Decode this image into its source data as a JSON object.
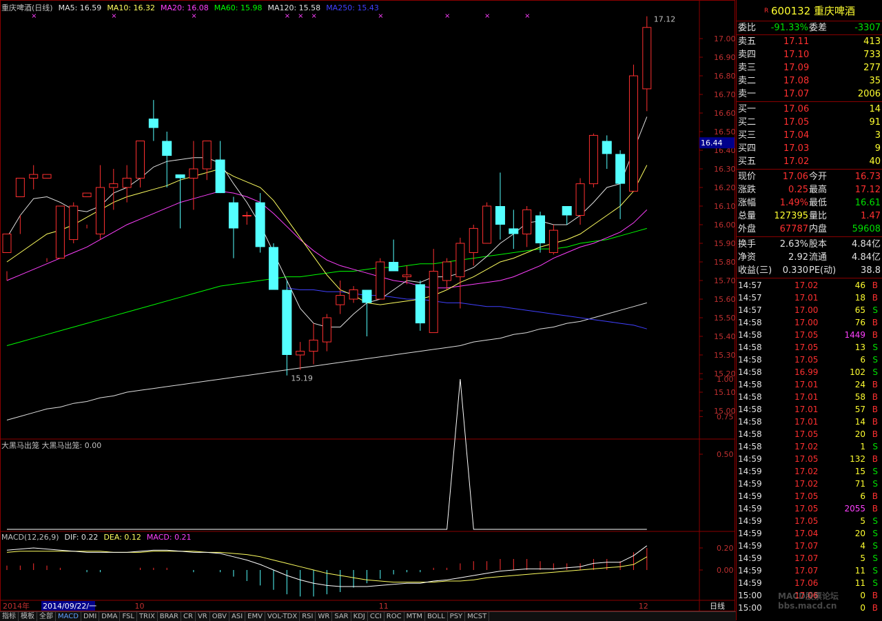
{
  "main_chart": {
    "legend": [
      {
        "text": "重庆啤酒(日线)",
        "color": "#c0c0c0"
      },
      {
        "text": "MA5: 16.59",
        "color": "#e0e0e0"
      },
      {
        "text": "MA10: 16.32",
        "color": "#ffff60"
      },
      {
        "text": "MA20: 16.08",
        "color": "#ff40ff"
      },
      {
        "text": "MA60: 15.98",
        "color": "#00ff00"
      },
      {
        "text": "MA120: 15.58",
        "color": "#e0e0e0"
      },
      {
        "text": "MA250: 15.43",
        "color": "#4040ff"
      }
    ],
    "price_ticks": [
      "17.00",
      "16.90",
      "16.80",
      "16.70",
      "16.60",
      "16.50",
      "16.40",
      "16.30",
      "16.20",
      "16.10",
      "16.00",
      "15.90",
      "15.80",
      "15.70",
      "15.60",
      "15.50",
      "15.40",
      "15.30",
      "15.20",
      "15.10",
      "15.00"
    ],
    "current_price_label": "16.44",
    "high_label": "17.12",
    "low_label": "15.19",
    "candles": [
      [
        15.85,
        15.95,
        15.75,
        15.7
      ],
      [
        16.15,
        16.25,
        16.05,
        15.95
      ],
      [
        16.25,
        16.27,
        16.32,
        16.19
      ],
      [
        16.25,
        16.27,
        15.8,
        15.82
      ],
      [
        15.82,
        16.1,
        15.95,
        15.82
      ],
      [
        15.92,
        16.1,
        16.12,
        15.9
      ],
      [
        16.15,
        16.17,
        16.0,
        15.98
      ],
      [
        15.95,
        16.2,
        16.32,
        15.92
      ],
      [
        16.2,
        16.22,
        16.3,
        16.08
      ],
      [
        16.2,
        16.25,
        16.32,
        16.12
      ],
      [
        16.25,
        16.45,
        16.45,
        16.2
      ],
      [
        16.57,
        16.52,
        16.67,
        16.45
      ],
      [
        16.45,
        16.37,
        16.5,
        16.2
      ],
      [
        16.27,
        16.25,
        16.27,
        15.98
      ],
      [
        16.25,
        16.3,
        16.45,
        16.08
      ],
      [
        16.3,
        16.45,
        16.45,
        16.24
      ],
      [
        16.35,
        16.17,
        16.45,
        16.17
      ],
      [
        16.12,
        15.98,
        16.15,
        15.82
      ],
      [
        16.05,
        16.05,
        16.07,
        16.0
      ],
      [
        16.12,
        15.88,
        16.17,
        15.85
      ],
      [
        15.88,
        15.65,
        15.9,
        15.65
      ],
      [
        15.65,
        15.3,
        15.7,
        15.19
      ],
      [
        15.3,
        15.32,
        15.37,
        15.22
      ],
      [
        15.32,
        15.38,
        15.47,
        15.25
      ],
      [
        15.37,
        15.5,
        15.52,
        15.32
      ],
      [
        15.57,
        15.62,
        15.7,
        15.52
      ],
      [
        15.6,
        15.65,
        15.67,
        15.58
      ],
      [
        15.65,
        15.58,
        15.65,
        15.4
      ],
      [
        15.6,
        15.8,
        15.82,
        15.6
      ],
      [
        15.8,
        15.75,
        15.92,
        15.75
      ],
      [
        15.72,
        15.73,
        15.78,
        15.68
      ],
      [
        15.68,
        15.47,
        15.7,
        15.43
      ],
      [
        15.42,
        15.75,
        15.87,
        15.42
      ],
      [
        15.7,
        15.8,
        15.82,
        15.65
      ],
      [
        15.72,
        15.9,
        15.93,
        15.55
      ],
      [
        15.85,
        15.98,
        16.0,
        15.78
      ],
      [
        15.9,
        16.1,
        16.12,
        15.9
      ],
      [
        16.1,
        16.0,
        16.28,
        15.92
      ],
      [
        15.98,
        15.95,
        16.08,
        15.87
      ],
      [
        15.95,
        16.08,
        16.1,
        15.88
      ],
      [
        16.05,
        15.9,
        16.07,
        15.85
      ],
      [
        15.85,
        15.97,
        16.0,
        15.84
      ],
      [
        16.1,
        16.05,
        16.1,
        16.0
      ],
      [
        16.05,
        16.22,
        16.25,
        16.0
      ],
      [
        16.22,
        16.48,
        16.49,
        16.2
      ],
      [
        16.45,
        16.38,
        16.48,
        16.3
      ],
      [
        16.38,
        16.22,
        16.4,
        16.03
      ],
      [
        16.18,
        16.8,
        16.86,
        16.18
      ],
      [
        16.73,
        17.06,
        17.12,
        16.61
      ]
    ],
    "ma5": [
      15.93,
      16.05,
      16.14,
      16.15,
      16.12,
      16.08,
      16.07,
      16.1,
      16.17,
      16.2,
      16.25,
      16.31,
      16.34,
      16.35,
      16.36,
      16.36,
      16.33,
      16.22,
      16.12,
      16.0,
      15.85,
      15.7,
      15.55,
      15.47,
      15.45,
      15.45,
      15.52,
      15.58,
      15.6,
      15.65,
      15.7,
      15.69,
      15.72,
      15.72,
      15.74,
      15.77,
      15.83,
      15.9,
      15.95,
      16.01,
      16.02,
      16.0,
      16.0,
      16.05,
      16.12,
      16.2,
      16.22,
      16.4,
      16.58
    ],
    "ma10": [
      15.8,
      15.85,
      15.9,
      15.95,
      15.97,
      16.0,
      16.04,
      16.08,
      16.12,
      16.15,
      16.17,
      16.19,
      16.21,
      16.24,
      16.26,
      16.28,
      16.3,
      16.26,
      16.23,
      16.2,
      16.13,
      16.03,
      15.93,
      15.83,
      15.73,
      15.65,
      15.62,
      15.58,
      15.57,
      15.58,
      15.59,
      15.6,
      15.62,
      15.65,
      15.69,
      15.72,
      15.76,
      15.8,
      15.82,
      15.85,
      15.88,
      15.9,
      15.92,
      15.95,
      16.0,
      16.05,
      16.1,
      16.18,
      16.32
    ],
    "ma20": [
      15.7,
      15.73,
      15.76,
      15.79,
      15.82,
      15.85,
      15.88,
      15.92,
      15.96,
      16.0,
      16.03,
      16.06,
      16.09,
      16.12,
      16.14,
      16.16,
      16.18,
      16.17,
      16.15,
      16.12,
      16.06,
      15.99,
      15.92,
      15.86,
      15.81,
      15.78,
      15.76,
      15.74,
      15.72,
      15.7,
      15.69,
      15.67,
      15.66,
      15.66,
      15.67,
      15.68,
      15.69,
      15.7,
      15.72,
      15.75,
      15.78,
      15.82,
      15.85,
      15.88,
      15.9,
      15.93,
      15.96,
      16.01,
      16.08
    ],
    "ma60": [
      15.35,
      15.37,
      15.39,
      15.41,
      15.43,
      15.45,
      15.47,
      15.49,
      15.51,
      15.53,
      15.55,
      15.57,
      15.59,
      15.61,
      15.63,
      15.65,
      15.67,
      15.68,
      15.69,
      15.7,
      15.71,
      15.72,
      15.72,
      15.73,
      15.74,
      15.75,
      15.75,
      15.76,
      15.77,
      15.77,
      15.78,
      15.79,
      15.79,
      15.8,
      15.81,
      15.82,
      15.83,
      15.84,
      15.85,
      15.86,
      15.87,
      15.87,
      15.88,
      15.9,
      15.91,
      15.92,
      15.94,
      15.96,
      15.98
    ],
    "ma120": [
      14.95,
      14.97,
      14.99,
      15.01,
      15.02,
      15.04,
      15.05,
      15.07,
      15.08,
      15.1,
      15.11,
      15.12,
      15.13,
      15.14,
      15.15,
      15.16,
      15.17,
      15.18,
      15.19,
      15.2,
      15.21,
      15.22,
      15.23,
      15.24,
      15.25,
      15.26,
      15.27,
      15.28,
      15.29,
      15.3,
      15.31,
      15.32,
      15.33,
      15.34,
      15.35,
      15.37,
      15.38,
      15.39,
      15.41,
      15.42,
      15.44,
      15.45,
      15.47,
      15.48,
      15.5,
      15.52,
      15.54,
      15.56,
      15.58
    ],
    "ma250_start": 21,
    "ma250": [
      15.66,
      15.65,
      15.65,
      15.64,
      15.64,
      15.63,
      15.62,
      15.62,
      15.61,
      15.6,
      15.6,
      15.59,
      15.58,
      15.58,
      15.57,
      15.56,
      15.56,
      15.55,
      15.54,
      15.53,
      15.52,
      15.51,
      15.5,
      15.49,
      15.48,
      15.47,
      15.46,
      15.44
    ]
  },
  "indicator1": {
    "title": "大黑马出笼  大黑马出笼: 0.00",
    "ticks": [
      "1.00",
      "0.75",
      "0.50"
    ],
    "spike_index": 34
  },
  "macd": {
    "legend": [
      {
        "text": "MACD(12,26,9)",
        "color": "#c0c0c0"
      },
      {
        "text": "DIF: 0.22",
        "color": "#e0e0e0"
      },
      {
        "text": "DEA: 0.12",
        "color": "#ffff60"
      },
      {
        "text": "MACD: 0.21",
        "color": "#ff40ff"
      }
    ],
    "ticks": [
      "0.20",
      "0.00"
    ],
    "dif": [
      0.18,
      0.19,
      0.2,
      0.19,
      0.18,
      0.17,
      0.16,
      0.16,
      0.16,
      0.16,
      0.17,
      0.18,
      0.18,
      0.17,
      0.16,
      0.16,
      0.15,
      0.12,
      0.09,
      0.05,
      0.0,
      -0.05,
      -0.09,
      -0.12,
      -0.14,
      -0.15,
      -0.15,
      -0.15,
      -0.14,
      -0.13,
      -0.12,
      -0.12,
      -0.1,
      -0.09,
      -0.07,
      -0.05,
      -0.03,
      -0.01,
      0.0,
      0.01,
      0.01,
      0.01,
      0.02,
      0.03,
      0.06,
      0.07,
      0.07,
      0.13,
      0.22
    ],
    "dea": [
      0.16,
      0.17,
      0.17,
      0.17,
      0.17,
      0.17,
      0.17,
      0.17,
      0.16,
      0.16,
      0.16,
      0.17,
      0.17,
      0.17,
      0.17,
      0.16,
      0.16,
      0.15,
      0.14,
      0.12,
      0.09,
      0.06,
      0.03,
      0.0,
      -0.03,
      -0.05,
      -0.07,
      -0.09,
      -0.1,
      -0.11,
      -0.11,
      -0.11,
      -0.11,
      -0.1,
      -0.1,
      -0.09,
      -0.07,
      -0.06,
      -0.05,
      -0.04,
      -0.03,
      -0.02,
      -0.01,
      0.0,
      0.01,
      0.02,
      0.03,
      0.05,
      0.12
    ],
    "hist": [
      0.04,
      0.04,
      0.06,
      0.04,
      0.02,
      0.0,
      -0.02,
      -0.02,
      0.0,
      0.0,
      0.02,
      0.02,
      0.02,
      0.0,
      -0.02,
      0.0,
      -0.02,
      -0.06,
      -0.1,
      -0.14,
      -0.18,
      -0.22,
      -0.24,
      -0.24,
      -0.22,
      -0.2,
      -0.16,
      -0.12,
      -0.08,
      -0.04,
      -0.02,
      -0.02,
      0.02,
      0.02,
      0.06,
      0.08,
      0.08,
      0.1,
      0.1,
      0.1,
      0.08,
      0.06,
      0.06,
      0.06,
      0.1,
      0.1,
      0.08,
      0.16,
      0.2
    ]
  },
  "date_axis": {
    "year": "2014年",
    "cursor_date": "2014/09/22/一",
    "m10": "10",
    "m11": "11",
    "m12": "12",
    "period": "日线"
  },
  "tabs": [
    "指标",
    "模板",
    "全部",
    "MACD",
    "DMI",
    "DMA",
    "FSL",
    "TRIX",
    "BRAR",
    "CR",
    "VR",
    "OBV",
    "ASI",
    "EMV",
    "VOL-TDX",
    "RSI",
    "WR",
    "SAR",
    "KDJ",
    "CCI",
    "ROC",
    "MTM",
    "BOLL",
    "PSY",
    "MCST"
  ],
  "quote": {
    "r_mark": "R",
    "code": "600132",
    "name": "重庆啤酒",
    "weibi_label": "委比",
    "weibi": "-91.33%",
    "weicha_label": "委差",
    "weicha": "-3307",
    "asks": [
      {
        "label": "卖五",
        "price": "17.11",
        "vol": "413"
      },
      {
        "label": "卖四",
        "price": "17.10",
        "vol": "733"
      },
      {
        "label": "卖三",
        "price": "17.09",
        "vol": "277"
      },
      {
        "label": "卖二",
        "price": "17.08",
        "vol": "35"
      },
      {
        "label": "卖一",
        "price": "17.07",
        "vol": "2006"
      }
    ],
    "bids": [
      {
        "label": "买一",
        "price": "17.06",
        "vol": "14"
      },
      {
        "label": "买二",
        "price": "17.05",
        "vol": "91"
      },
      {
        "label": "买三",
        "price": "17.04",
        "vol": "3"
      },
      {
        "label": "买四",
        "price": "17.03",
        "vol": "9"
      },
      {
        "label": "买五",
        "price": "17.02",
        "vol": "40"
      }
    ],
    "stats": [
      {
        "l1": "现价",
        "v1": "17.06",
        "c1": "red",
        "l2": "今开",
        "v2": "16.73",
        "c2": "red"
      },
      {
        "l1": "涨跌",
        "v1": "0.25",
        "c1": "red",
        "l2": "最高",
        "v2": "17.12",
        "c2": "red"
      },
      {
        "l1": "涨幅",
        "v1": "1.49%",
        "c1": "red",
        "l2": "最低",
        "v2": "16.61",
        "c2": "green"
      },
      {
        "l1": "总量",
        "v1": "127395",
        "c1": "yellow",
        "l2": "量比",
        "v2": "1.47",
        "c2": "red"
      },
      {
        "l1": "外盘",
        "v1": "67787",
        "c1": "red",
        "l2": "内盘",
        "v2": "59608",
        "c2": "green"
      }
    ],
    "stats2": [
      {
        "l1": "换手",
        "v1": "2.63%",
        "l2": "股本",
        "v2": "4.84亿"
      },
      {
        "l1": "净资",
        "v1": "2.92",
        "l2": "流通",
        "v2": "4.84亿"
      },
      {
        "l1": "收益(三)",
        "v1": "0.330",
        "l2": "PE(动)",
        "v2": "38.8"
      }
    ],
    "ticks": [
      {
        "t": "14:57",
        "p": "17.02",
        "v": "46",
        "s": "B"
      },
      {
        "t": "14:57",
        "p": "17.01",
        "v": "18",
        "s": "B"
      },
      {
        "t": "14:57",
        "p": "17.00",
        "v": "65",
        "s": "S"
      },
      {
        "t": "14:58",
        "p": "17.00",
        "v": "76",
        "s": "B"
      },
      {
        "t": "14:58",
        "p": "17.05",
        "v": "1449",
        "s": "B"
      },
      {
        "t": "14:58",
        "p": "17.05",
        "v": "13",
        "s": "S"
      },
      {
        "t": "14:58",
        "p": "17.05",
        "v": "6",
        "s": "S"
      },
      {
        "t": "14:58",
        "p": "16.99",
        "v": "102",
        "s": "S"
      },
      {
        "t": "14:58",
        "p": "17.01",
        "v": "24",
        "s": "B"
      },
      {
        "t": "14:58",
        "p": "17.01",
        "v": "58",
        "s": "B"
      },
      {
        "t": "14:58",
        "p": "17.01",
        "v": "57",
        "s": "B"
      },
      {
        "t": "14:58",
        "p": "17.01",
        "v": "14",
        "s": "B"
      },
      {
        "t": "14:58",
        "p": "17.05",
        "v": "20",
        "s": "B"
      },
      {
        "t": "14:58",
        "p": "17.02",
        "v": "1",
        "s": "S"
      },
      {
        "t": "14:59",
        "p": "17.05",
        "v": "132",
        "s": "B"
      },
      {
        "t": "14:59",
        "p": "17.02",
        "v": "15",
        "s": "S"
      },
      {
        "t": "14:59",
        "p": "17.02",
        "v": "71",
        "s": "S"
      },
      {
        "t": "14:59",
        "p": "17.05",
        "v": "6",
        "s": "B"
      },
      {
        "t": "14:59",
        "p": "17.05",
        "v": "2055",
        "s": "B"
      },
      {
        "t": "14:59",
        "p": "17.05",
        "v": "5",
        "s": "S"
      },
      {
        "t": "14:59",
        "p": "17.04",
        "v": "20",
        "s": "S"
      },
      {
        "t": "14:59",
        "p": "17.07",
        "v": "4",
        "s": "S"
      },
      {
        "t": "14:59",
        "p": "17.07",
        "v": "5",
        "s": "S"
      },
      {
        "t": "14:59",
        "p": "17.07",
        "v": "11",
        "s": "S"
      },
      {
        "t": "14:59",
        "p": "17.06",
        "v": "11",
        "s": "S"
      },
      {
        "t": "15:00",
        "p": "17.06",
        "v": "0",
        "s": "B"
      },
      {
        "t": "15:00",
        "p": "",
        "v": "0",
        "s": "B"
      }
    ],
    "watermark": "MACD股票论坛 bbs.macd.cn"
  },
  "colors": {
    "up": "#ff3030",
    "down": "#54ffff",
    "frame": "#8b0000"
  }
}
